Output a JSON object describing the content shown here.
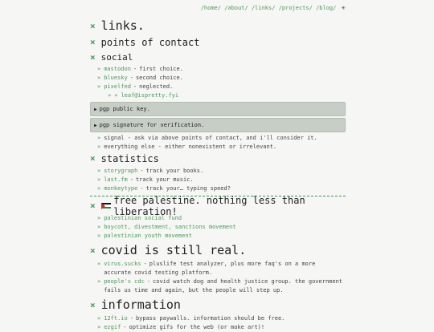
{
  "nav": {
    "items": [
      "/home/",
      "/about/",
      "/links/",
      "/projects/",
      "/blog/"
    ],
    "theme_icon": "sun-icon"
  },
  "page": {
    "marker": "×",
    "bullet": "»",
    "separator": "-",
    "title": "links."
  },
  "points_of_contact": {
    "heading": "points of contact",
    "social": {
      "heading": "social",
      "items": [
        {
          "link": "mastodon",
          "desc": "first choice."
        },
        {
          "link": "bluesky",
          "desc": "second choice."
        },
        {
          "link": "pixelfed",
          "desc": "neglected."
        }
      ],
      "sub_item": {
        "link": "leaf@ispretty.fyi"
      }
    },
    "pgp_key": "pgp public key.",
    "pgp_signature": "pgp signature for verification.",
    "extra": [
      "signal - ask via above points of contact, and i'll consider it.",
      "everything else - either nonexistent or irrelevant."
    ]
  },
  "statistics": {
    "heading": "statistics",
    "items": [
      {
        "link": "storygraph",
        "desc": "track your books."
      },
      {
        "link": "last.fm",
        "desc": "track your music."
      },
      {
        "link": "monkeytype",
        "desc": "track your… typing speed?"
      }
    ]
  },
  "palestine": {
    "heading": "free palestine. nothing less than liberation!",
    "items": [
      "palestinian social fund",
      "boycott, divestment, sanctions movement",
      "palestinian youth movement"
    ]
  },
  "covid": {
    "heading": "covid is still real.",
    "items": [
      {
        "link": "virus.sucks",
        "desc": "pluslife test analyzer, plus more faq's on a more accurate covid testing platform."
      },
      {
        "link": "people's cdc",
        "desc": "covid watch dog and health justice group. the government fails us time and again, but the people will step up."
      }
    ]
  },
  "information": {
    "heading": "information",
    "items": [
      {
        "link": "12ft.io",
        "desc": "bypass paywalls. information should be free."
      },
      {
        "link": "ezgif",
        "desc": "optimize gifs for the web (or make art)!"
      }
    ]
  }
}
